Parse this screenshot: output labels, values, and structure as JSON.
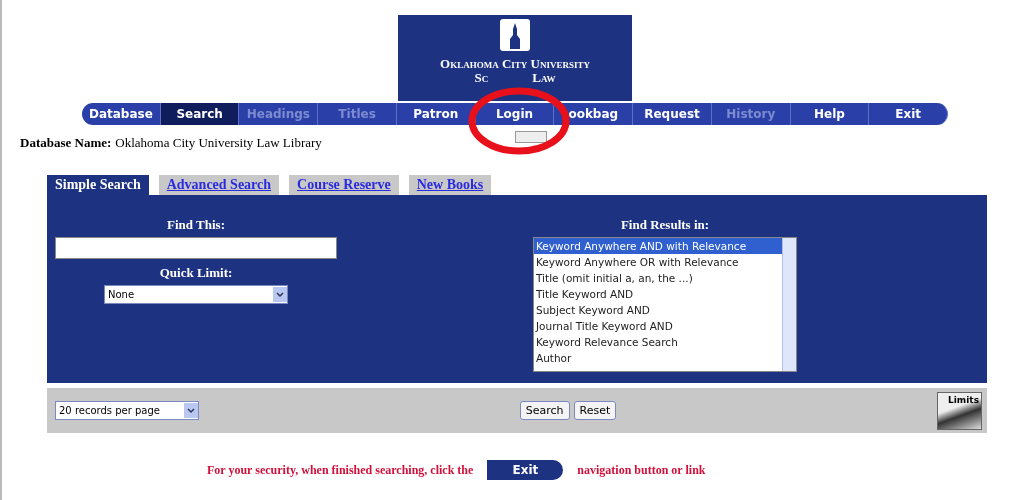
{
  "logo": {
    "line_1": "Oklahoma City University",
    "line_2_start": "Sc",
    "line_2_end": "Law"
  },
  "nav": [
    {
      "label": "Database",
      "kind": "end",
      "disabled": false,
      "selected": false
    },
    {
      "label": "Search",
      "kind": "middle",
      "disabled": false,
      "selected": true
    },
    {
      "label": "Headings",
      "kind": "middle",
      "disabled": true,
      "selected": false
    },
    {
      "label": "Titles",
      "kind": "middle",
      "disabled": true,
      "selected": false
    },
    {
      "label": "Patron",
      "kind": "middle",
      "disabled": false,
      "selected": false
    },
    {
      "label": "Login",
      "kind": "middle",
      "disabled": false,
      "selected": false
    },
    {
      "label": "ookbag",
      "kind": "middle",
      "disabled": false,
      "selected": false
    },
    {
      "label": "Request",
      "kind": "middle",
      "disabled": false,
      "selected": false
    },
    {
      "label": "History",
      "kind": "middle",
      "disabled": true,
      "selected": false
    },
    {
      "label": "Help",
      "kind": "middle",
      "disabled": false,
      "selected": false
    },
    {
      "label": "Exit",
      "kind": "end",
      "disabled": false,
      "selected": false
    }
  ],
  "database_name": {
    "label": "Database Name:",
    "value": "Oklahoma City University Law Library"
  },
  "tabs": [
    {
      "label": "Simple Search",
      "selected": true
    },
    {
      "label": "Advanced Search",
      "selected": false
    },
    {
      "label": "Course Reserve",
      "selected": false
    },
    {
      "label": "New Books",
      "selected": false
    }
  ],
  "find_this": {
    "label": "Find This:"
  },
  "quick_limit": {
    "label": "Quick Limit:",
    "value": "None"
  },
  "find_results": {
    "label": "Find Results in:",
    "options": [
      {
        "label": "Keyword Anywhere AND with Relevance",
        "selected": true
      },
      {
        "label": "Keyword Anywhere OR with Relevance",
        "selected": false
      },
      {
        "label": "Title (omit initial a, an, the ...)",
        "selected": false
      },
      {
        "label": "Title Keyword AND",
        "selected": false
      },
      {
        "label": "Subject Keyword AND",
        "selected": false
      },
      {
        "label": "Journal Title Keyword AND",
        "selected": false
      },
      {
        "label": "Keyword Relevance Search",
        "selected": false
      },
      {
        "label": "Author",
        "selected": false
      }
    ]
  },
  "per_page": {
    "value": "20 records per page"
  },
  "buttons": [
    "Search",
    "Reset"
  ],
  "limits_button": "Limits",
  "footer": {
    "before": "For your security, when finished searching, click the",
    "button": "Exit",
    "after": "navigation button or link"
  }
}
